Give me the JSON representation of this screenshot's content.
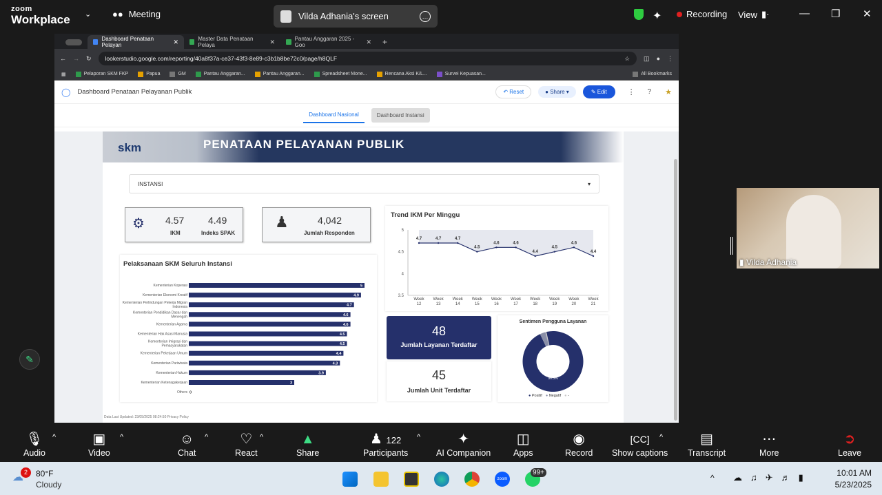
{
  "zoom": {
    "brand_small": "zoom",
    "brand_big": "Workplace",
    "meeting_label": "Meeting",
    "screen_label": "Vilda Adhania's screen",
    "recording_label": "Recording",
    "view_label": "View"
  },
  "browser": {
    "tabs": [
      {
        "label": "Dashboard Penataan Pelayan",
        "color": "#4285f4"
      },
      {
        "label": "Master Data Penataan Pelaya",
        "color": "#34a853"
      },
      {
        "label": "Pantau Anggaran 2025 - Goo",
        "color": "#34a853"
      }
    ],
    "url": "lookerstudio.google.com/reporting/40a8f37a-ce37-43f3-8e89-c3b1b8be72c0/page/h8QLF",
    "bookmarks": [
      "Pelaporan SKM FKP",
      "Papua",
      "GM",
      "Pantau Anggaran...",
      "Pantau Anggaran...",
      "Spreadsheet Mone...",
      "Rencana Aksi K/L...",
      "Survei Kepuasan..."
    ],
    "all_bookmarks": "All Bookmarks"
  },
  "looker": {
    "title": "Dashboard Penataan Pelayanan Publik",
    "reset": "Reset",
    "share": "Share",
    "edit": "Edit",
    "nav": [
      "Dashboard Nasional",
      "Dashboard Instansi"
    ]
  },
  "report": {
    "banner_logo": "skm",
    "banner_title": "PENATAAN PELAYANAN PUBLIK",
    "dropdown_label": "INSTANSI",
    "kpi": {
      "ikm_value": "4.57",
      "ikm_label": "IKM",
      "spak_value": "4.49",
      "spak_label": "Indeks SPAK",
      "resp_value": "4,042",
      "resp_label": "Jumlah Responden"
    },
    "trend_title": "Trend IKM Per Minggu",
    "bars_title": "Pelaksanaan SKM Seluruh Instansi",
    "layanan_value": "48",
    "layanan_label": "Jumlah Layanan Terdaftar",
    "unit_value": "45",
    "unit_label": "Jumlah Unit Terdaftar",
    "donut_title": "Sentimen Pengguna Layanan",
    "donut_label": "96.5%",
    "donut_legend": [
      "Positif",
      "Negatif",
      "-"
    ],
    "footer": "Data Last Updated: 23/05/2025 08:24:50   Privacy Policy"
  },
  "chart_data": [
    {
      "type": "line",
      "title": "Trend IKM Per Minggu",
      "x": [
        "Week 12",
        "Week 13",
        "Week 14",
        "Week 15",
        "Week 16",
        "Week 17",
        "Week 18",
        "Week 19",
        "Week 20",
        "Week 21"
      ],
      "values": [
        4.7,
        4.7,
        4.7,
        4.5,
        4.6,
        4.6,
        4.4,
        4.5,
        4.6,
        4.4
      ],
      "ylim": [
        3.5,
        5
      ],
      "yticks": [
        "5",
        "4.5",
        "4",
        "3.5"
      ]
    },
    {
      "type": "bar",
      "title": "Pelaksanaan SKM Seluruh Instansi",
      "categories": [
        "Kementerian Koperasi",
        "Kementerian Ekonomi Kreatif",
        "Kementerian Perlindungan Pekerja Migran Indonesia",
        "Kementerian Pendidikan Dasar dan Menengah",
        "Kementerian Agama",
        "Kementerian Hak Asasi Manusia",
        "Kementerian Imigrasi dan Pemasyarakatan",
        "Kementerian Pekerjaan Umum",
        "Kementerian Pariwisata",
        "Kementerian Hukum",
        "Kementerian Ketenagakerjaan",
        "Others"
      ],
      "values": [
        5,
        4.9,
        4.7,
        4.6,
        4.6,
        4.5,
        4.5,
        4.4,
        4.3,
        3.9,
        3,
        0
      ],
      "xlim": [
        0,
        5
      ]
    },
    {
      "type": "pie",
      "title": "Sentimen Pengguna Layanan",
      "categories": [
        "Positif",
        "Negatif",
        "-"
      ],
      "values": [
        96.5,
        3.0,
        0.5
      ],
      "colors": [
        "#25306b",
        "#8a8fa8",
        "#c8c8c8"
      ]
    }
  ],
  "participant": {
    "name": "Vilda Adhania"
  },
  "controls": [
    "Audio",
    "Video",
    "Chat",
    "React",
    "Share",
    "Participants",
    "AI Companion",
    "Apps",
    "Record",
    "Show captions",
    "Transcript",
    "More",
    "Leave"
  ],
  "participants_count": "122",
  "taskbar": {
    "temp": "80°F",
    "weather": "Cloudy",
    "weather_badge": "2",
    "time": "10:01 AM",
    "date": "5/23/2025",
    "whatsapp_badge": "99+"
  }
}
